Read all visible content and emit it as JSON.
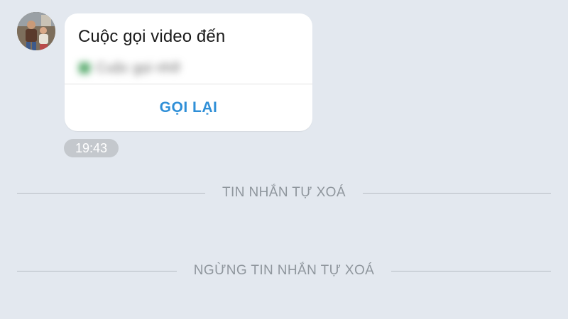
{
  "message": {
    "avatar_icon": "contact-photo",
    "call_card": {
      "title": "Cuộc gọi video đến",
      "status": "Cuộc gọi nhỡ",
      "status_note": "blurred",
      "call_back_label": "GỌI LẠI"
    },
    "time": "19:43"
  },
  "separators": [
    "TIN NHẮN TỰ XOÁ",
    "NGỪNG TIN NHẮN TỰ XOÁ"
  ],
  "colors": {
    "background": "#e3e8ef",
    "card": "#ffffff",
    "accent": "#2f8fd7",
    "timestamp_bg": "#c4c8cd",
    "separator_text": "#8f969d"
  }
}
